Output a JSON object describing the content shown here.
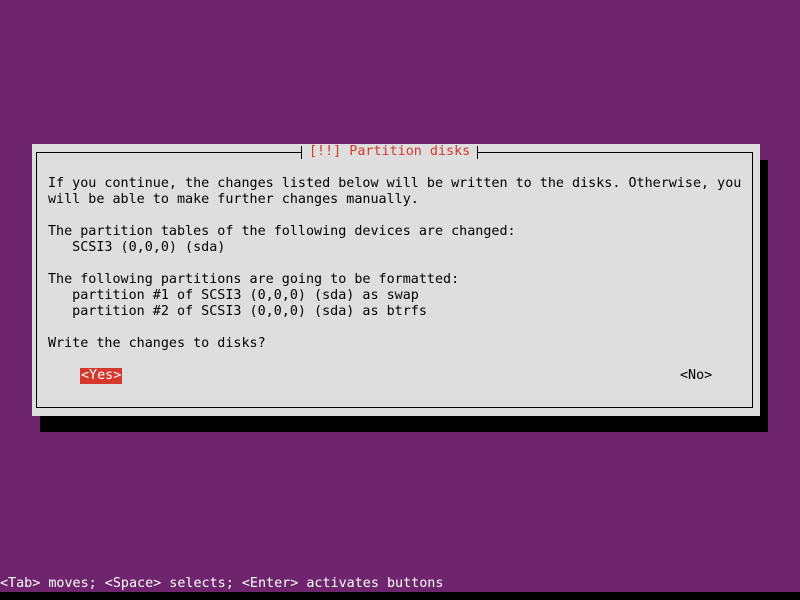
{
  "dialog": {
    "title": "[!!] Partition disks",
    "lines": [
      "If you continue, the changes listed below will be written to the disks. Otherwise, you",
      "will be able to make further changes manually.",
      "",
      "The partition tables of the following devices are changed:",
      "   SCSI3 (0,0,0) (sda)",
      "",
      "The following partitions are going to be formatted:",
      "   partition #1 of SCSI3 (0,0,0) (sda) as swap",
      "   partition #2 of SCSI3 (0,0,0) (sda) as btrfs",
      "",
      "Write the changes to disks?"
    ],
    "buttons": {
      "yes": "<Yes>",
      "no": "<No>"
    }
  },
  "statusbar": {
    "help": "<Tab> moves; <Space> selects; <Enter> activates buttons"
  },
  "colors": {
    "background": "#6f246e",
    "dialog": "#dedede",
    "accent": "#d4382c"
  }
}
